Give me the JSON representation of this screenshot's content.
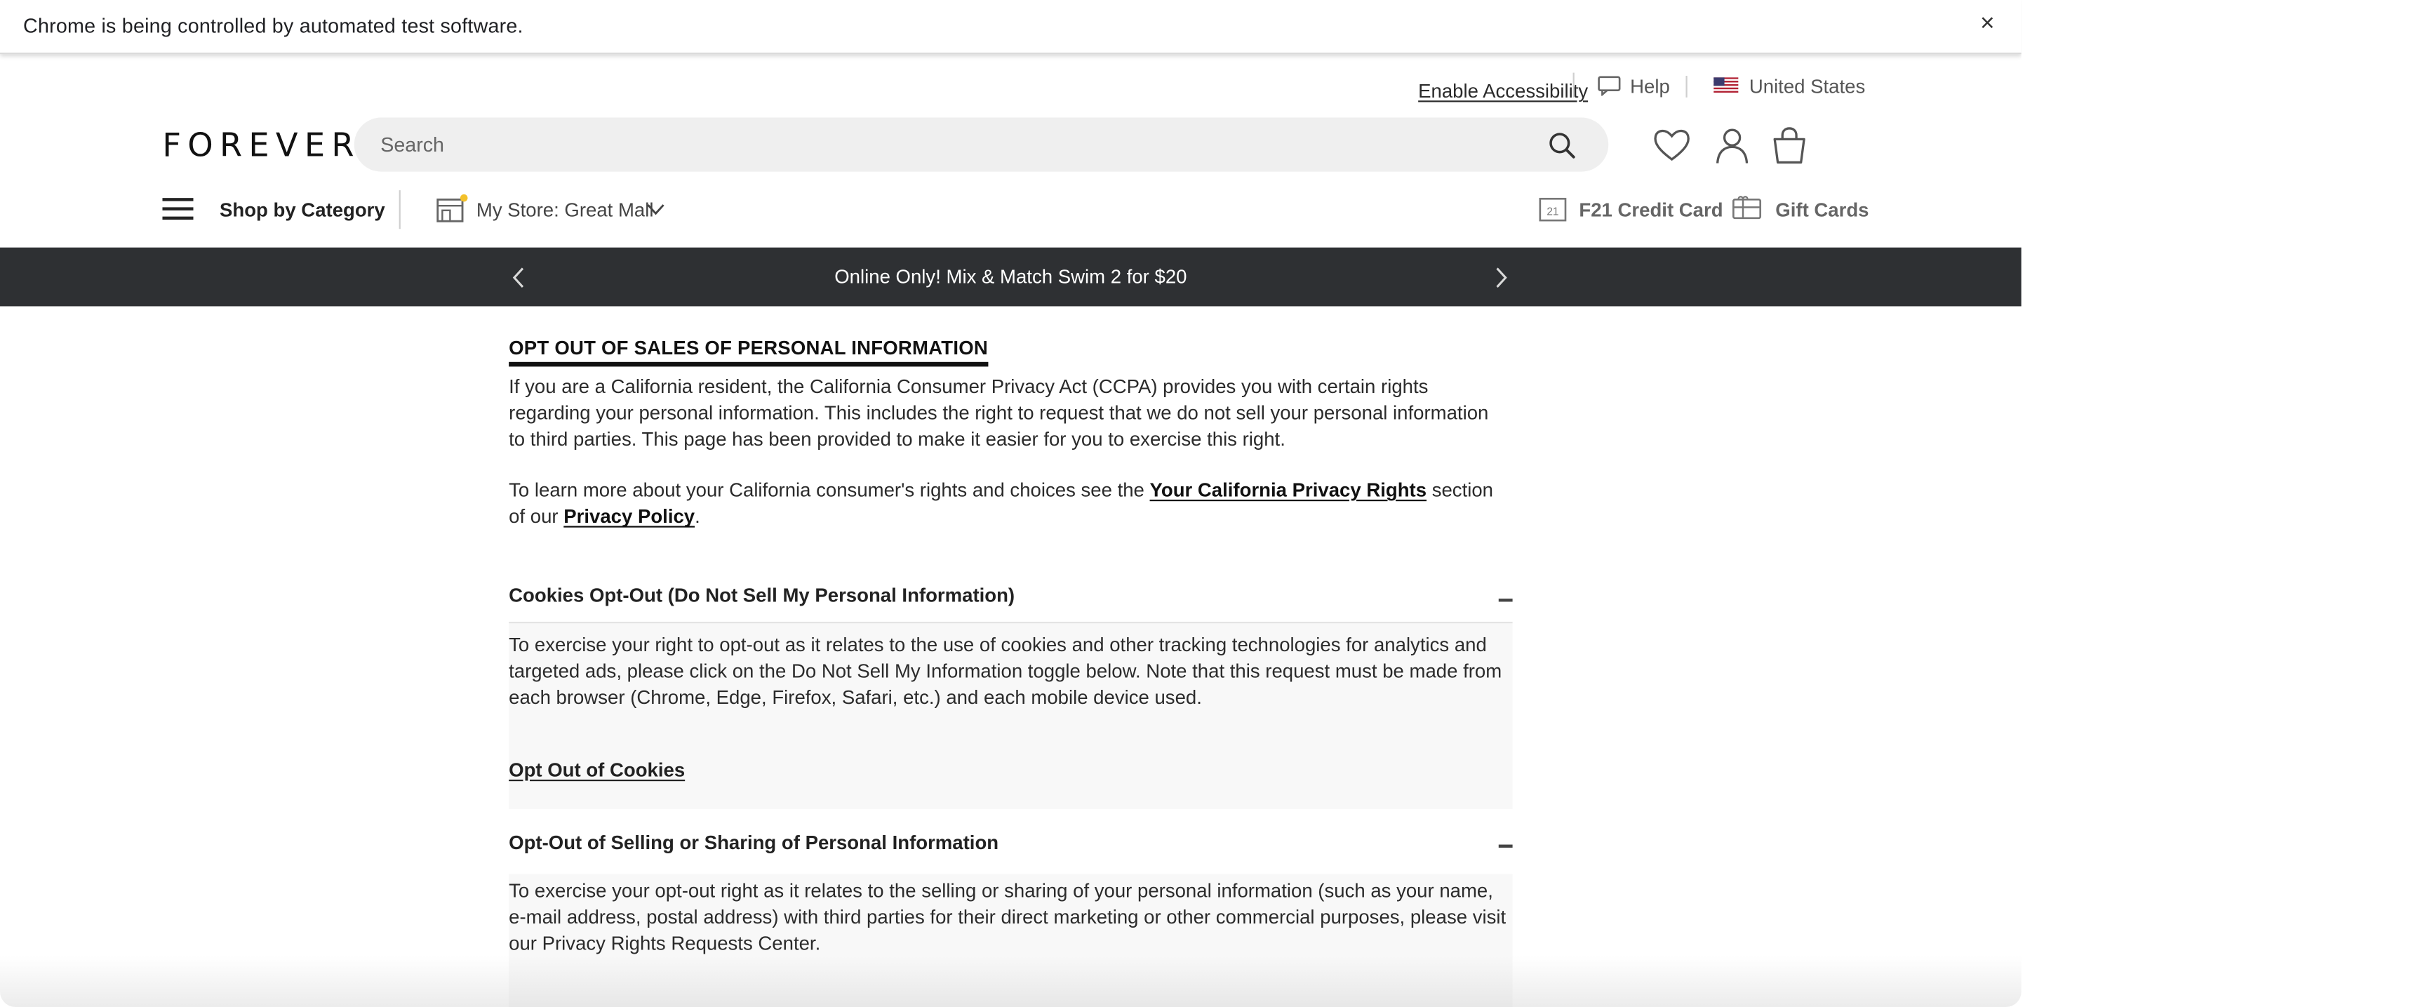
{
  "automation_bar": {
    "message": "Chrome is being controlled by automated test software.",
    "close_glyph": "×"
  },
  "header": {
    "accessibility_link": "Enable Accessibility",
    "help_label": "Help",
    "country_label": "United States",
    "logo_text": "FOREVER 21",
    "search_placeholder": "Search",
    "icons": [
      "search-icon",
      "heart-icon",
      "user-icon",
      "bag-icon"
    ]
  },
  "nav": {
    "shop_by_category": "Shop by Category",
    "my_store": "My Store: Great Mall",
    "credit_card": "F21 Credit Card",
    "gift_cards": "Gift Cards"
  },
  "promo": {
    "text": "Online Only! Mix & Match Swim 2 for $20"
  },
  "content": {
    "title": "OPT OUT OF SALES OF PERSONAL INFORMATION",
    "intro": "If you are a California resident, the California Consumer Privacy Act (CCPA) provides you with certain rights regarding your personal information. This includes the right to request that we do not sell your personal information to third parties. This page has been provided to make it easier for you to exercise this right.",
    "learn_more_prefix": "To learn more about your California consumer's rights and choices see the ",
    "rights_link": "Your California Privacy Rights",
    "learn_more_middle": " section of our ",
    "privacy_policy_link": "Privacy Policy",
    "learn_more_suffix": ".",
    "sections": [
      {
        "heading": "Cookies Opt-Out (Do Not Sell My Personal Information)",
        "toggle": "–",
        "body": "To exercise your right to opt-out as it relates to the use of cookies and other tracking technologies for analytics and targeted ads, please click on the Do Not Sell My Information toggle below. Note that this request must be made from each browser (Chrome, Edge, Firefox, Safari, etc.) and each mobile device used.",
        "link": "Opt Out of Cookies"
      },
      {
        "heading": "Opt-Out of Selling or Sharing of Personal Information",
        "toggle": "–",
        "body": "To exercise your opt-out right as it relates to the selling or sharing of your personal information (such as your name, e-mail address, postal address) with third parties for their direct marketing or other commercial purposes, please visit our Privacy Rights Requests Center."
      }
    ]
  },
  "colors": {
    "promo_bg": "#2e3033",
    "panel_bg": "#f8f8f8",
    "text": "#2b2b2b"
  }
}
